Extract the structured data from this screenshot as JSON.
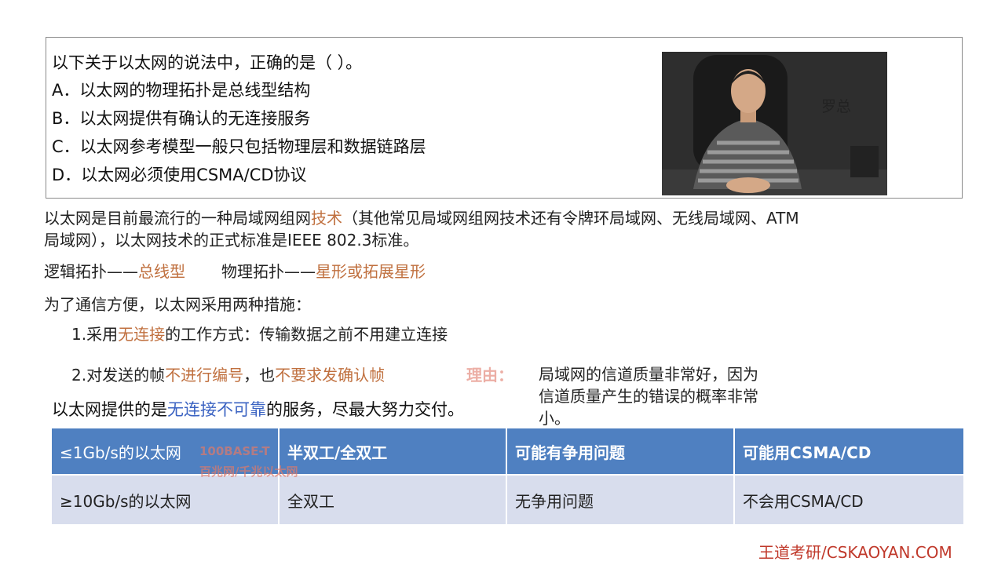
{
  "question": {
    "stem": "以下关于以太网的说法中，正确的是（          ）。",
    "options": [
      "A．以太网的物理拓扑是总线型结构",
      "B．以太网提供有确认的无连接服务",
      "C．以太网参考模型一般只包括物理层和数据链路层",
      "D．以太网必须使用CSMA/CD协议"
    ]
  },
  "presenter": {
    "name": "罗总"
  },
  "notes": {
    "intro_a": "以太网是目前最流行的一种局域网组网",
    "intro_hl": "技术",
    "intro_b": "（其他常见局域网组网技术还有令牌环局域网、无线局域网、ATM",
    "intro_line2": "局域网），以太网技术的正式标准是IEEE 802.3标准。",
    "logic_label": "逻辑拓扑——",
    "logic_value": "总线型",
    "physical_label": "物理拓扑——",
    "physical_value": "星形或拓展星形",
    "measures_title": "为了通信方便，以太网采用两种措施：",
    "m1_a": "1.采用",
    "m1_hl": "无连接",
    "m1_b": "的工作方式：传输数据之前不用建立连接",
    "m2_a": "2.对发送的帧",
    "m2_hl1": "不进行编号",
    "m2_b": "，也",
    "m2_hl2": "不要求发确认帧",
    "reason_label": "理由：",
    "reason_line1": "局域网的信道质量非常好，因为",
    "reason_line2": "信道质量产生的错误的概率非常",
    "reason_line3": "小。",
    "summary_a": "以太网提供的是",
    "summary_hl": "无连接不可靠",
    "summary_b": "的服务，尽最大努力交付。"
  },
  "table": {
    "header": [
      "≤1Gb/s的以太网",
      "半双工/全双工",
      "可能有争用问题",
      "可能用CSMA/CD"
    ],
    "row": [
      "≥10Gb/s的以太网",
      "全双工",
      "无争用问题",
      "不会用CSMA/CD"
    ],
    "overlay_line1": "100BASE-T",
    "overlay_line2": "百兆网/千兆以太网"
  },
  "watermark": "王道考研/CSKAOYAN.COM",
  "colors": {
    "table_header": "#4f80c1",
    "table_row": "#d8dded",
    "highlight_orange": "#c0703f",
    "highlight_blue": "#3b63c2"
  }
}
